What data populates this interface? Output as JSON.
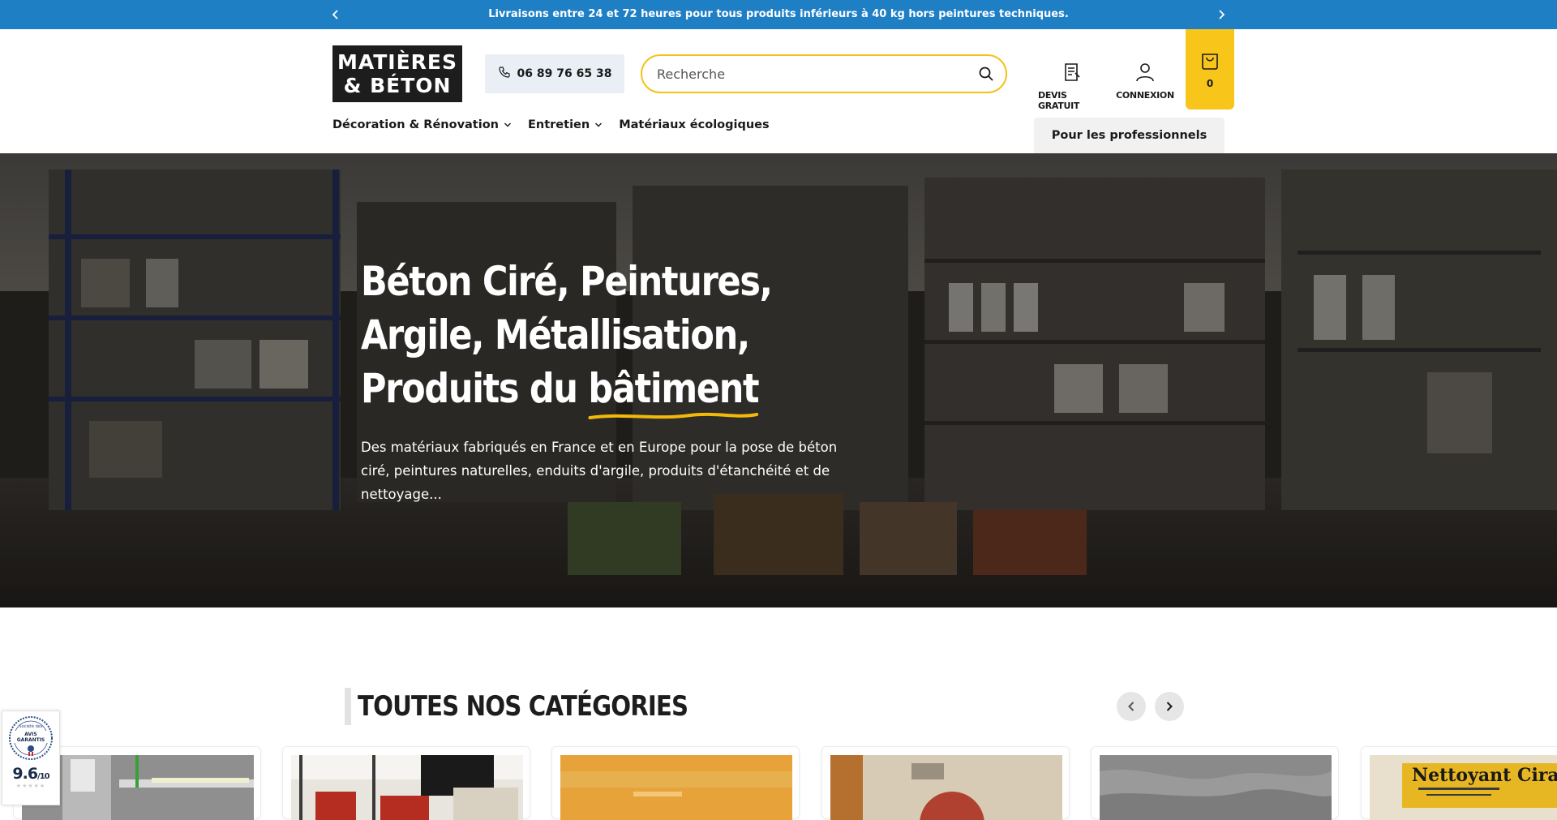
{
  "announcement": {
    "message": "Livraisons entre 24 et 72 heures pour tous produits inférieurs à 40 kg hors peintures techniques."
  },
  "header": {
    "logo_line1": "MATIÈRES",
    "logo_line2": "& BÉTON",
    "phone": "06 89 76 65 38",
    "search_placeholder": "Recherche",
    "devis_label": "DEVIS GRATUIT",
    "connexion_label": "CONNEXION",
    "cart_count": "0"
  },
  "nav": {
    "items": [
      {
        "label": "Décoration & Rénovation",
        "dropdown": true
      },
      {
        "label": "Entretien",
        "dropdown": true
      },
      {
        "label": "Matériaux écologiques",
        "dropdown": false
      }
    ],
    "pro_label": "Pour les professionnels"
  },
  "hero": {
    "line1": "Béton Ciré, Peintures,",
    "line2": "Argile, Métallisation,",
    "line3_prefix": "Produits du ",
    "line3_underlined": "bâtiment",
    "description": "Des matériaux fabriqués en France et en Europe pour la pose de béton ciré, peintures naturelles,  enduits d'argile, produits d'étanchéité et de nettoyage..."
  },
  "categories": {
    "title": "TOUTES NOS CATÉGORIES"
  },
  "reviews_badge": {
    "seal_top": "Société des",
    "seal_main": "AVIS GARANTIS",
    "score": "9.6",
    "score_suffix": "/10"
  },
  "colors": {
    "announcement_bg": "#1f7fc5",
    "accent_yellow": "#f8c51b",
    "phone_bg": "#e9eff5"
  }
}
